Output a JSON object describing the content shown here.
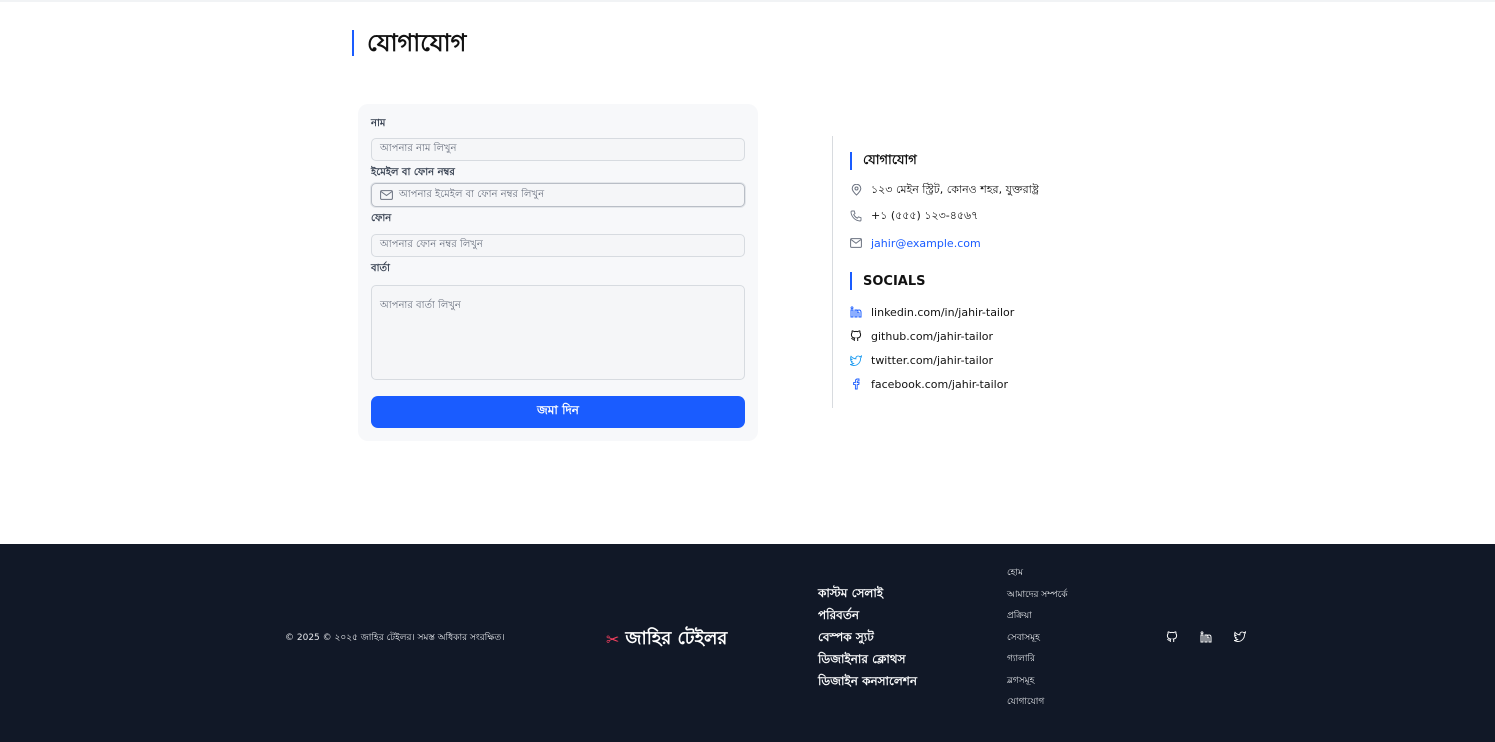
{
  "page": {
    "title": "যোগাযোগ"
  },
  "form": {
    "name_label": "নাম",
    "name_placeholder": "আপনার নাম লিখুন",
    "email_label": "ইমেইল বা ফোন নম্বর",
    "email_placeholder": "আপনার ইমেইল বা ফোন নম্বর লিখুন",
    "phone_label": "ফোন",
    "phone_placeholder": "আপনার ফোন নম্বর লিখুন",
    "message_label": "বার্তা",
    "message_placeholder": "আপনার বার্তা লিখুন",
    "submit_label": "জমা দিন"
  },
  "contact": {
    "heading": "যোগাযোগ",
    "address": "১২৩ মেইন স্ট্রিট, কোনও শহর, যুক্তরাষ্ট্র",
    "phone": "+১ (৫৫৫) ১২৩-৪৫৬৭",
    "email": "jahir@example.com"
  },
  "socials": {
    "heading": "SOCIALS",
    "items": [
      {
        "icon": "linkedin-icon",
        "text": "linkedin.com/in/jahir-tailor"
      },
      {
        "icon": "github-icon",
        "text": "github.com/jahir-tailor"
      },
      {
        "icon": "twitter-icon",
        "text": "twitter.com/jahir-tailor"
      },
      {
        "icon": "facebook-icon",
        "text": "facebook.com/jahir-tailor"
      }
    ]
  },
  "footer": {
    "copyright": "© 2025 © ২০২৫ জাহির টেইলর। সমস্ত অধিকার সংরক্ষিত।",
    "brand": "জাহির টেইলর",
    "brand_icon": "✂",
    "services": [
      "কাস্টম সেলাই",
      "পরিবর্তন",
      "বেস্পক স্যুট",
      "ডিজাইনার ক্লোথস",
      "ডিজাইন কনসালেশন"
    ],
    "links": [
      "হোম",
      "আমাদের সম্পর্কে",
      "প্রক্রিয়া",
      "সেবাসমূহ",
      "গ্যালারি",
      "ব্লগসমূহ",
      "যোগাযোগ"
    ]
  },
  "colors": {
    "accent": "#1a5cff",
    "footer_bg": "#111827",
    "brand_icon": "#f43f5e"
  }
}
